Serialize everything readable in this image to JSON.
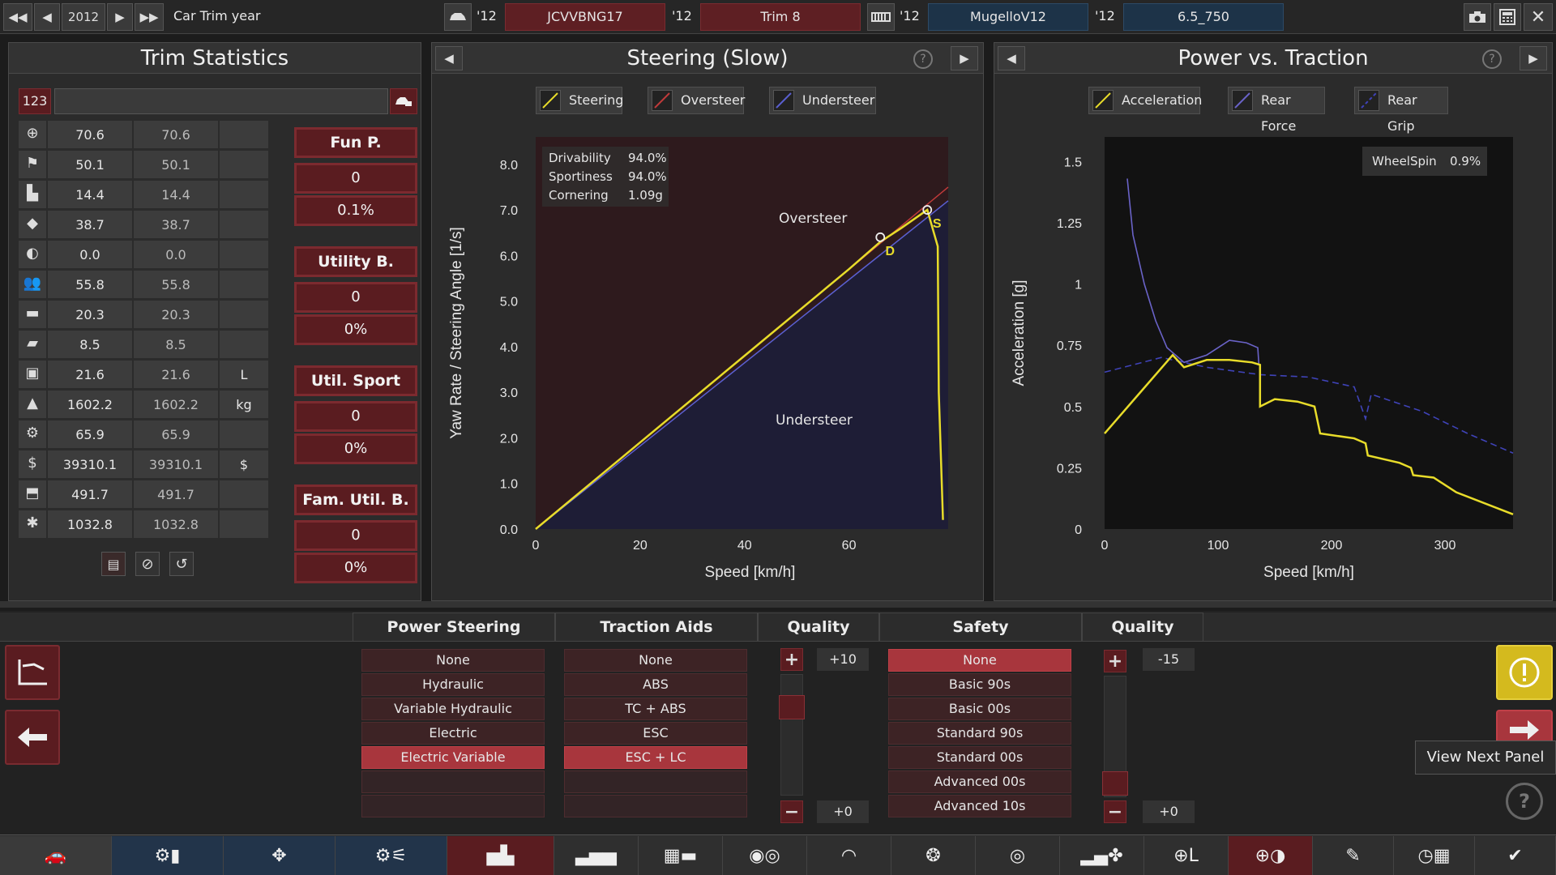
{
  "topbar": {
    "year": "2012",
    "year_label": "Car Trim year",
    "car_year": "'12",
    "car_name": "JCVVBNG17",
    "trim_year": "'12",
    "trim_name": "Trim 8",
    "engine_year": "'12",
    "engine_name": "MugelloV12",
    "variant_year": "'12",
    "variant_name": "6.5_750"
  },
  "trim_stats": {
    "title": "Trim Statistics",
    "search_value": "123",
    "rows": [
      {
        "icon": "steering-wheel-icon",
        "a": "70.6",
        "b": "70.6",
        "unit": ""
      },
      {
        "icon": "race-flag-icon",
        "a": "50.1",
        "b": "50.1",
        "unit": ""
      },
      {
        "icon": "car-seat-icon",
        "a": "14.4",
        "b": "14.4",
        "unit": ""
      },
      {
        "icon": "diamond-icon",
        "a": "38.7",
        "b": "38.7",
        "unit": ""
      },
      {
        "icon": "safety-icon",
        "a": "0.0",
        "b": "0.0",
        "unit": ""
      },
      {
        "icon": "passengers-icon",
        "a": "55.8",
        "b": "55.8",
        "unit": ""
      },
      {
        "icon": "cargo-car-icon",
        "a": "20.3",
        "b": "20.3",
        "unit": ""
      },
      {
        "icon": "offroad-car-icon",
        "a": "8.5",
        "b": "8.5",
        "unit": ""
      },
      {
        "icon": "fuel-icon",
        "a": "21.6",
        "b": "21.6",
        "unit": "L"
      },
      {
        "icon": "weight-icon",
        "a": "1602.2",
        "b": "1602.2",
        "unit": "kg"
      },
      {
        "icon": "engineering-icon",
        "a": "65.9",
        "b": "65.9",
        "unit": ""
      },
      {
        "icon": "cost-icon",
        "a": "39310.1",
        "b": "39310.1",
        "unit": "$"
      },
      {
        "icon": "production-icon",
        "a": "491.7",
        "b": "491.7",
        "unit": ""
      },
      {
        "icon": "service-icon",
        "a": "1032.8",
        "b": "1032.8",
        "unit": ""
      }
    ],
    "groups": [
      {
        "name": "Fun P.",
        "v1": "0",
        "v2": "0.1%"
      },
      {
        "name": "Utility B.",
        "v1": "0",
        "v2": "0%"
      },
      {
        "name": "Util. Sport",
        "v1": "0",
        "v2": "0%"
      },
      {
        "name": "Fam. Util. B.",
        "v1": "0",
        "v2": "0%"
      }
    ]
  },
  "steering": {
    "title": "Steering (Slow)",
    "legend": [
      "Steering",
      "Oversteer",
      "Understeer"
    ],
    "stats": [
      {
        "label": "Drivability",
        "value": "94.0%"
      },
      {
        "label": "Sportiness",
        "value": "94.0%"
      },
      {
        "label": "Cornering",
        "value": "1.09g"
      }
    ],
    "region_oversteer": "Oversteer",
    "region_understeer": "Understeer",
    "marker_d": "D",
    "marker_s": "S",
    "colors": {
      "steering": "#e8dc2a",
      "oversteer": "#c03a3a",
      "understeer": "#5a5fd0"
    }
  },
  "power": {
    "title": "Power vs. Traction",
    "legend": [
      "Acceleration",
      "Rear Force",
      "Rear Grip"
    ],
    "wheelspin_label": "WheelSpin",
    "wheelspin_value": "0.9%",
    "colors": {
      "acceleration": "#e8dc2a",
      "rear_force": "#6a63c8",
      "rear_grip": "#3f43b8"
    }
  },
  "chart_data": [
    {
      "type": "line",
      "title": "Steering (Slow)",
      "xlabel": "Speed [km/h]",
      "ylabel": "Yaw Rate / Steering Angle [1/s]",
      "xlim": [
        0,
        79
      ],
      "ylim": [
        0,
        8.6
      ],
      "x_ticks": [
        "0",
        "20",
        "40",
        "60"
      ],
      "y_ticks": [
        "0.0",
        "1.0",
        "2.0",
        "3.0",
        "4.0",
        "5.0",
        "6.0",
        "7.0",
        "8.0"
      ],
      "series": [
        {
          "name": "Steering",
          "x": [
            0,
            20,
            40,
            60,
            66,
            70,
            75,
            77,
            77.2,
            78
          ],
          "y": [
            0,
            1.9,
            3.8,
            5.7,
            6.3,
            6.6,
            7.0,
            6.2,
            3.0,
            0.2
          ]
        },
        {
          "name": "Oversteer",
          "x": [
            0,
            79
          ],
          "y": [
            0,
            7.5
          ]
        },
        {
          "name": "Understeer",
          "x": [
            0,
            79
          ],
          "y": [
            0,
            7.2
          ]
        }
      ],
      "markers": [
        {
          "label": "D",
          "x": 66,
          "y": 6.4
        },
        {
          "label": "S",
          "x": 75,
          "y": 7.0
        }
      ]
    },
    {
      "type": "line",
      "title": "Power vs. Traction",
      "xlabel": "Speed [km/h]",
      "ylabel": "Acceleration [g]",
      "xlim": [
        0,
        360
      ],
      "ylim": [
        0,
        1.6
      ],
      "x_ticks": [
        "0",
        "100",
        "200",
        "300"
      ],
      "y_ticks": [
        "0",
        "0.25",
        "0.5",
        "0.75",
        "1",
        "1.25",
        "1.5"
      ],
      "series": [
        {
          "name": "Acceleration",
          "x": [
            0,
            30,
            60,
            70,
            90,
            110,
            130,
            137,
            137,
            150,
            170,
            185,
            190,
            220,
            230,
            232,
            260,
            270,
            272,
            290,
            300,
            310,
            360
          ],
          "y": [
            0.39,
            0.55,
            0.71,
            0.66,
            0.69,
            0.69,
            0.68,
            0.67,
            0.5,
            0.53,
            0.52,
            0.5,
            0.39,
            0.37,
            0.35,
            0.3,
            0.27,
            0.25,
            0.22,
            0.21,
            0.18,
            0.15,
            0.06
          ]
        },
        {
          "name": "Rear Force",
          "x": [
            20,
            25,
            35,
            45,
            55,
            70,
            90,
            110,
            125,
            135,
            136
          ],
          "y": [
            1.43,
            1.2,
            1.0,
            0.85,
            0.74,
            0.68,
            0.71,
            0.77,
            0.76,
            0.74,
            0.67
          ]
        },
        {
          "name": "Rear Grip",
          "x": [
            0,
            50,
            90,
            137,
            180,
            220,
            230,
            235,
            280,
            320,
            360
          ],
          "y": [
            0.64,
            0.7,
            0.66,
            0.63,
            0.62,
            0.58,
            0.45,
            0.55,
            0.48,
            0.39,
            0.31
          ]
        }
      ]
    }
  ],
  "bottom": {
    "power_steering": {
      "title": "Power Steering",
      "options": [
        "None",
        "Hydraulic",
        "Variable Hydraulic",
        "Electric",
        "Electric Variable"
      ],
      "selected": 4
    },
    "traction_aids": {
      "title": "Traction Aids",
      "options": [
        "None",
        "ABS",
        "TC + ABS",
        "ESC",
        "ESC + LC"
      ],
      "selected": 4
    },
    "quality1": {
      "title": "Quality",
      "top": "+10",
      "bottom": "+0"
    },
    "safety": {
      "title": "Safety",
      "options": [
        "None",
        "Basic 90s",
        "Basic 00s",
        "Standard 90s",
        "Standard 00s",
        "Advanced 00s",
        "Advanced 10s"
      ],
      "selected": 0
    },
    "quality2": {
      "title": "Quality",
      "top": "-15",
      "bottom": "+0"
    },
    "tooltip": "View Next Panel"
  }
}
